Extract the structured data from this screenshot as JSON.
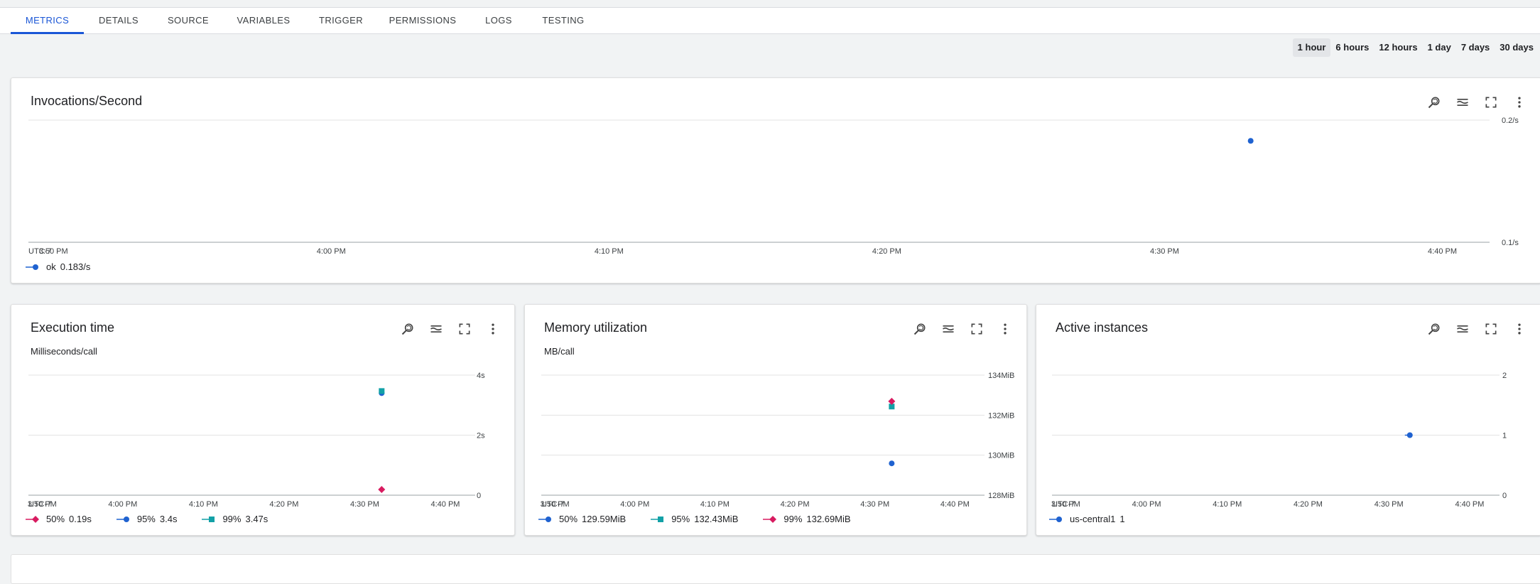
{
  "tabs": [
    {
      "label": "METRICS",
      "active": true
    },
    {
      "label": "DETAILS"
    },
    {
      "label": "SOURCE"
    },
    {
      "label": "VARIABLES"
    },
    {
      "label": "TRIGGER"
    },
    {
      "label": "PERMISSIONS"
    },
    {
      "label": "LOGS"
    },
    {
      "label": "TESTING"
    }
  ],
  "time_ranges": [
    {
      "label": "1 hour",
      "active": true
    },
    {
      "label": "6 hours"
    },
    {
      "label": "12 hours"
    },
    {
      "label": "1 day"
    },
    {
      "label": "7 days"
    },
    {
      "label": "30 days"
    }
  ],
  "card_icons": [
    "zoom-reset-icon",
    "legend-toggle-icon",
    "fullscreen-icon",
    "more-vert-icon"
  ],
  "colors": {
    "blue": "#1f62d0",
    "teal": "#12a1a7",
    "magenta": "#d81b60",
    "accent": "#1a56d6"
  },
  "chart_data": [
    {
      "id": "invocations",
      "type": "scatter",
      "title": "Invocations/Second",
      "subtitle": "",
      "timezone": "UTC-7",
      "x_ticks": [
        "3:50 PM",
        "4:00 PM",
        "4:10 PM",
        "4:20 PM",
        "4:30 PM",
        "4:40 PM"
      ],
      "x_tick_minutes": [
        230,
        240,
        250,
        260,
        270,
        280
      ],
      "x_range_minutes": [
        229.1,
        281.7
      ],
      "y_ticks": [
        {
          "v": 0.2,
          "label": "0.2/s"
        },
        {
          "v": 0.1,
          "label": "0.1/s"
        }
      ],
      "ylim": [
        0.1,
        0.2
      ],
      "series": [
        {
          "name": "ok",
          "legend_value": "0.183/s",
          "marker": "circle",
          "color": "#1f62d0",
          "points": [
            [
              273.1,
              0.183
            ]
          ]
        }
      ]
    },
    {
      "id": "execution",
      "type": "scatter",
      "title": "Execution time",
      "subtitle": "Milliseconds/call",
      "timezone": "UTC-7",
      "x_ticks": [
        "3:50 PM",
        "4:00 PM",
        "4:10 PM",
        "4:20 PM",
        "4:30 PM",
        "4:40 PM"
      ],
      "x_tick_minutes": [
        230,
        240,
        250,
        260,
        270,
        280
      ],
      "x_range_minutes": [
        228.3,
        283.7
      ],
      "y_ticks": [
        {
          "v": 4,
          "label": "4s"
        },
        {
          "v": 2,
          "label": "2s"
        },
        {
          "v": 0,
          "label": "0"
        }
      ],
      "ylim": [
        0,
        4
      ],
      "series": [
        {
          "name": "50%",
          "legend_value": "0.19s",
          "marker": "diamond",
          "color": "#d81b60",
          "points": [
            [
              272.1,
              0.19
            ]
          ]
        },
        {
          "name": "95%",
          "legend_value": "3.4s",
          "marker": "circle",
          "color": "#1f62d0",
          "points": [
            [
              272.1,
              3.4
            ]
          ]
        },
        {
          "name": "99%",
          "legend_value": "3.47s",
          "marker": "square",
          "color": "#12a1a7",
          "points": [
            [
              272.1,
              3.47
            ]
          ]
        }
      ]
    },
    {
      "id": "memory",
      "type": "scatter",
      "title": "Memory utilization",
      "subtitle": "MB/call",
      "timezone": "UTC-7",
      "x_ticks": [
        "3:50 PM",
        "4:00 PM",
        "4:10 PM",
        "4:20 PM",
        "4:30 PM",
        "4:40 PM"
      ],
      "x_tick_minutes": [
        230,
        240,
        250,
        260,
        270,
        280
      ],
      "x_range_minutes": [
        228.3,
        283.7
      ],
      "y_ticks": [
        {
          "v": 134,
          "label": "134MiB"
        },
        {
          "v": 132,
          "label": "132MiB"
        },
        {
          "v": 130,
          "label": "130MiB"
        },
        {
          "v": 128,
          "label": "128MiB"
        }
      ],
      "ylim": [
        128,
        134
      ],
      "series": [
        {
          "name": "50%",
          "legend_value": "129.59MiB",
          "marker": "circle",
          "color": "#1f62d0",
          "points": [
            [
              272.1,
              129.59
            ]
          ]
        },
        {
          "name": "95%",
          "legend_value": "132.43MiB",
          "marker": "square",
          "color": "#12a1a7",
          "points": [
            [
              272.1,
              132.43
            ]
          ]
        },
        {
          "name": "99%",
          "legend_value": "132.69MiB",
          "marker": "diamond",
          "color": "#d81b60",
          "points": [
            [
              272.1,
              132.69
            ]
          ]
        }
      ]
    },
    {
      "id": "instances",
      "type": "scatter",
      "title": "Active instances",
      "subtitle": "",
      "timezone": "UTC-7",
      "x_ticks": [
        "3:50 PM",
        "4:00 PM",
        "4:10 PM",
        "4:20 PM",
        "4:30 PM",
        "4:40 PM"
      ],
      "x_tick_minutes": [
        230,
        240,
        250,
        260,
        270,
        280
      ],
      "x_range_minutes": [
        228.3,
        283.7
      ],
      "y_ticks": [
        {
          "v": 2,
          "label": "2"
        },
        {
          "v": 1,
          "label": "1"
        },
        {
          "v": 0,
          "label": "0"
        }
      ],
      "ylim": [
        0,
        2
      ],
      "series": [
        {
          "name": "us-central1",
          "legend_value": "1",
          "marker": "circle",
          "color": "#1f62d0",
          "points": [
            [
              272.6,
              1
            ]
          ],
          "stub": true
        }
      ]
    }
  ]
}
